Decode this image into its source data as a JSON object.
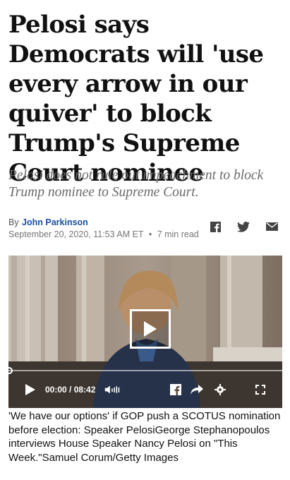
{
  "article": {
    "headline": "Pelosi says Democrats will 'use every arrow in our quiver' to block Trump's Supreme Court nominee",
    "subhead": "Pelosi does not rule out impeachment to block Trump nominee to Supreme Court.",
    "byline_prefix": "By",
    "author": "John Parkinson",
    "date": "September 20, 2020, 11:53 AM ET",
    "separator": "•",
    "read_time": "7 min read"
  },
  "share": {
    "icons": [
      "facebook-icon",
      "twitter-icon",
      "email-icon"
    ]
  },
  "video": {
    "time_display": "00:00 / 08:42",
    "progress": 0,
    "caption": "'We have our options' if GOP push a SCOTUS nomination before election: Speaker PelosiGeorge Stephanopoulos interviews House Speaker Nancy Pelosi on \"This Week.\"Samuel Corum/Getty Images"
  },
  "colors": {
    "author_link": "#1a4fa0",
    "subhead": "#6b6b6b",
    "video_bg": "#6b5a4e"
  }
}
